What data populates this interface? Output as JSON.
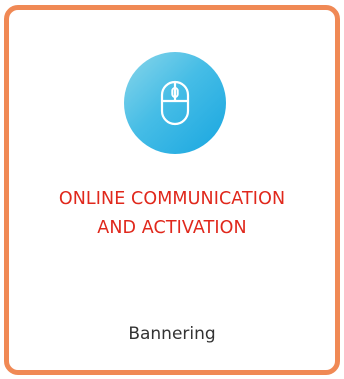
{
  "card": {
    "icon": "computer-mouse-icon",
    "title_line1": "ONLINE COMMUNICATION",
    "title_line2": "AND ACTIVATION",
    "subtitle": "Bannering"
  },
  "colors": {
    "border": "#f08955",
    "title": "#e0281c",
    "icon_gradient_start": "#8ad6ea",
    "icon_gradient_end": "#18a6e0",
    "subtitle": "#333333"
  }
}
